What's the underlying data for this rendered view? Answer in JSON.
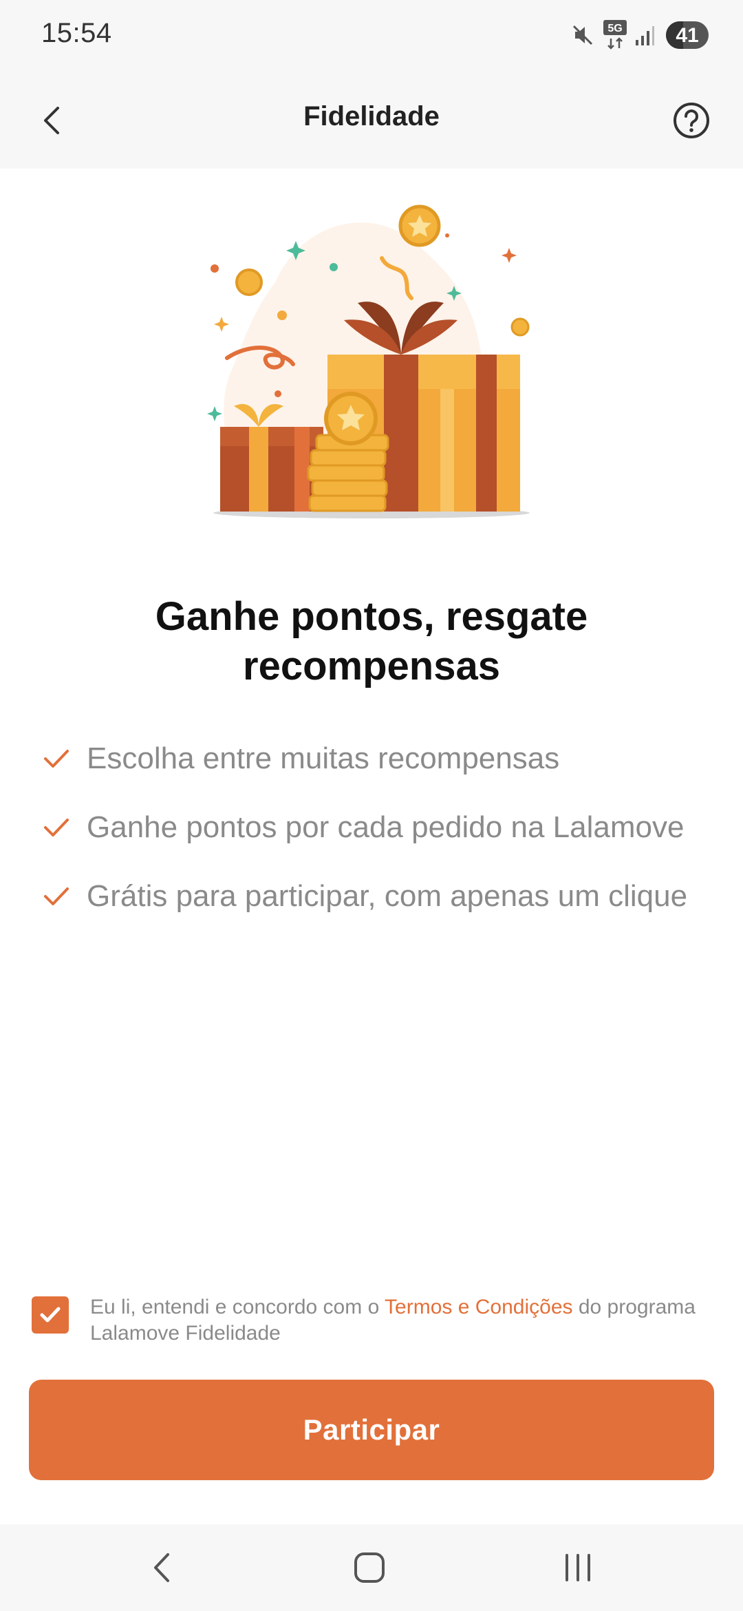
{
  "status_bar": {
    "time": "15:54",
    "network": "5G",
    "battery_level": "41",
    "battery_percent": 41
  },
  "app_bar": {
    "title": "Fidelidade",
    "back_icon": "chevron-left-icon",
    "help_icon": "question-circle-icon"
  },
  "hero": {
    "illustration": "gift-boxes-with-coins-illustration"
  },
  "headline": "Ganhe pontos, resgate recompensas",
  "benefits": [
    {
      "text": "Escolha entre muitas recompensas",
      "icon": "check-icon"
    },
    {
      "text": "Ganhe pontos por cada pedido na Lalamove",
      "icon": "check-icon"
    },
    {
      "text": "Grátis para participar, com apenas um clique",
      "icon": "check-icon"
    }
  ],
  "terms": {
    "checked": true,
    "prefix": "Eu li, entendi e concordo com o ",
    "link": "Termos e Condições",
    "suffix": " do programa Lalamove Fidelidade"
  },
  "primary_button": {
    "label": "Participar"
  },
  "colors": {
    "accent": "#e2703a",
    "text_primary": "#111111",
    "text_secondary": "#8a8a8a",
    "bar_background": "#f7f7f7"
  },
  "nav_bar": {
    "back": "nav-back-icon",
    "home": "nav-home-icon",
    "recents": "nav-recents-icon"
  }
}
